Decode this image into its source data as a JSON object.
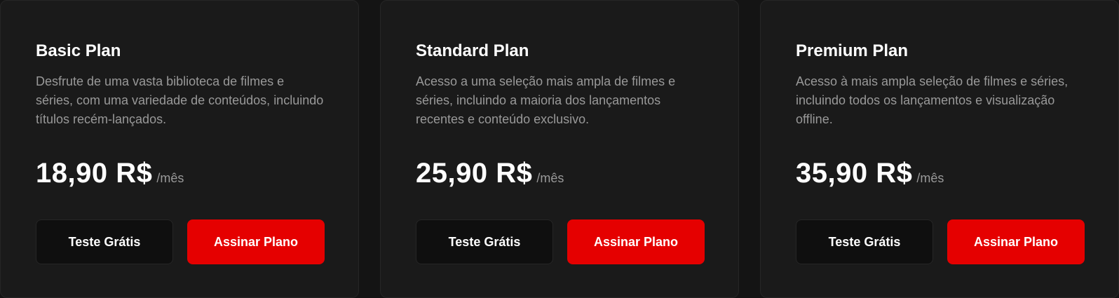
{
  "plans": [
    {
      "title": "Basic Plan",
      "description": "Desfrute de uma vasta biblioteca de filmes e séries, com uma variedade de conteúdos, incluindo títulos recém-lançados.",
      "price": "18,90 R$",
      "period": "/mês",
      "trial_label": "Teste Grátis",
      "subscribe_label": "Assinar Plano"
    },
    {
      "title": "Standard Plan",
      "description": "Acesso a uma seleção mais ampla de filmes e séries, incluindo a maioria dos lançamentos recentes e conteúdo exclusivo.",
      "price": "25,90 R$",
      "period": "/mês",
      "trial_label": "Teste Grátis",
      "subscribe_label": "Assinar Plano"
    },
    {
      "title": "Premium Plan",
      "description": "Acesso à mais ampla seleção de filmes e séries, incluindo todos os lançamentos e visualização offline.",
      "price": "35,90 R$",
      "period": "/mês",
      "trial_label": "Teste Grátis",
      "subscribe_label": "Assinar Plano"
    }
  ],
  "colors": {
    "background": "#141414",
    "card": "#1a1a1a",
    "accent": "#e50000",
    "secondary_button": "#0f0f0f",
    "muted_text": "#999999"
  }
}
